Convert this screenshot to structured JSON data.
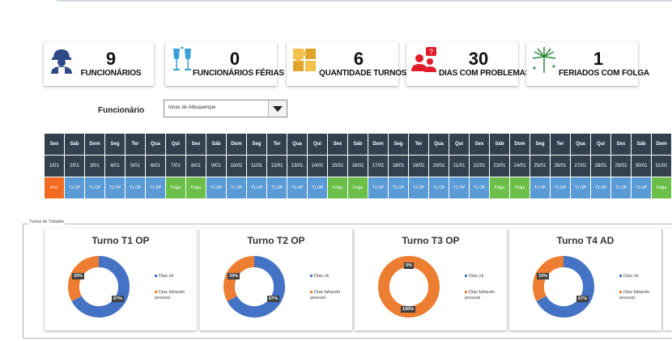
{
  "cards": [
    {
      "number": "9",
      "label": "FUNCIONÁRIOS",
      "icon": "worker-icon"
    },
    {
      "number": "0",
      "label": "FUNCIONÁRIOS FÉRIAS",
      "icon": "champagne-icon"
    },
    {
      "number": "6",
      "label": "QUANTIDADE TURNOS",
      "icon": "puzzle-icon"
    },
    {
      "number": "30",
      "label": "DIAS COM PROBLEMAS",
      "icon": "people-question-icon"
    },
    {
      "number": "1",
      "label": "FERIADOS COM FOLGA",
      "icon": "fireworks-icon"
    }
  ],
  "filter": {
    "label": "Funcionário",
    "value": "Ionas de Albuquerque"
  },
  "weekdays": [
    "Sex",
    "Sáb",
    "Dom",
    "Seg",
    "Ter",
    "Qua",
    "Qui",
    "Sex",
    "Sáb",
    "Dom",
    "Seg",
    "Ter",
    "Qua",
    "Qui",
    "Sex",
    "Sáb",
    "Dom",
    "Seg",
    "Ter",
    "Qua",
    "Qui",
    "Sex",
    "Sáb",
    "Dom",
    "Seg",
    "Ter",
    "Qua",
    "Qui",
    "Sex",
    "Sáb",
    "Dom"
  ],
  "dates": [
    "1/01",
    "2/01",
    "3/01",
    "4/01",
    "5/01",
    "6/01",
    "7/01",
    "8/01",
    "9/01",
    "10/01",
    "11/01",
    "12/01",
    "13/01",
    "14/01",
    "15/01",
    "16/01",
    "17/01",
    "18/01",
    "19/01",
    "20/01",
    "21/01",
    "22/01",
    "23/01",
    "24/01",
    "25/01",
    "26/01",
    "27/01",
    "28/01",
    "29/01",
    "30/01",
    "31/01"
  ],
  "shifts": [
    "Fnd.",
    "T1 OP",
    "T1 OP",
    "T1 OP",
    "T1 OP",
    "T1 OP",
    "Folga",
    "Folga",
    "T1 OP",
    "T1 OP",
    "T1 OP",
    "T1 OP",
    "T1 OP",
    "T1 OP",
    "Folga",
    "Folga",
    "T1 OP",
    "T1 OP",
    "T1 OP",
    "T1 OP",
    "T1 OP",
    "T1 OP",
    "Folga",
    "Folga",
    "T1 OP",
    "T1 OP",
    "T1 OP",
    "T1 OP",
    "T1 OP",
    "T1 OP",
    "Folga"
  ],
  "colors": {
    "header": "#33414f",
    "shift": "#5b9bd5",
    "off": "#6cc04a",
    "holiday": "#f26b21",
    "ok": "#4472c4",
    "missing": "#ed7d31"
  },
  "panel_title": "Turnos de Trabalho",
  "turnos": [
    {
      "title": "Turno T1 OP",
      "ok_pct": 67,
      "missing_pct": 33,
      "ok_label": "67%",
      "missing_label": "33%",
      "legend_ok": "Dias ok",
      "legend_missing": "Dias faltando pessoal"
    },
    {
      "title": "Turno T2 OP",
      "ok_pct": 67,
      "missing_pct": 33,
      "ok_label": "67%",
      "missing_label": "33%",
      "legend_ok": "Dias ok",
      "legend_missing": "Dias faltando pessoal"
    },
    {
      "title": "Turno T3 OP",
      "ok_pct": 0,
      "missing_pct": 100,
      "ok_label": "0%",
      "missing_label": "100%",
      "legend_ok": "Dias ok",
      "legend_missing": "Dias faltando pessoal"
    },
    {
      "title": "Turno T4 AD",
      "ok_pct": 67,
      "missing_pct": 33,
      "ok_label": "67%",
      "missing_label": "33%",
      "legend_ok": "Dias ok",
      "legend_missing": "Dias faltando pessoal"
    }
  ]
}
